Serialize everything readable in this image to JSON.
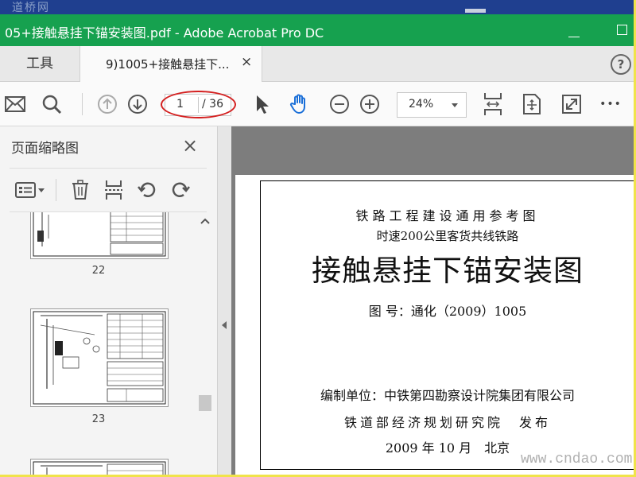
{
  "window": {
    "watermark_top": "道桥网",
    "title": "05+接触悬挂下锚安装图.pdf - Adobe Acrobat Pro DC"
  },
  "tabs": {
    "tools_label": "工具",
    "doc_label": "9)1005+接触悬挂下...",
    "close_glyph": "×",
    "help_glyph": "?"
  },
  "toolbar": {
    "current_page": "1",
    "total_pages": "/ 36",
    "zoom": "24%",
    "more_glyph": "•••"
  },
  "sidebar": {
    "title": "页面缩略图",
    "close_glyph": "×",
    "thumbnails": [
      {
        "page": "22"
      },
      {
        "page": "23"
      }
    ]
  },
  "document": {
    "line1": "铁路工程建设通用参考图",
    "line2": "时速200公里客货共线铁路",
    "title": "接触悬挂下锚安装图",
    "drawing_number": "图 号：通化（2009）1005",
    "compiler": "编制单位：中铁第四勘察设计院集团有限公司",
    "publisher": "铁道部经济规划研究院　发布",
    "date": "2009 年 10 月　北京"
  },
  "watermark_bottom": "www.cndao.com",
  "colors": {
    "title_bar": "#16a14f",
    "top_strip": "#1f3f8f",
    "outer_border": "#f0e34a",
    "annotation_circle": "#d42020",
    "hand_tool_active": "#1a6fd8"
  }
}
